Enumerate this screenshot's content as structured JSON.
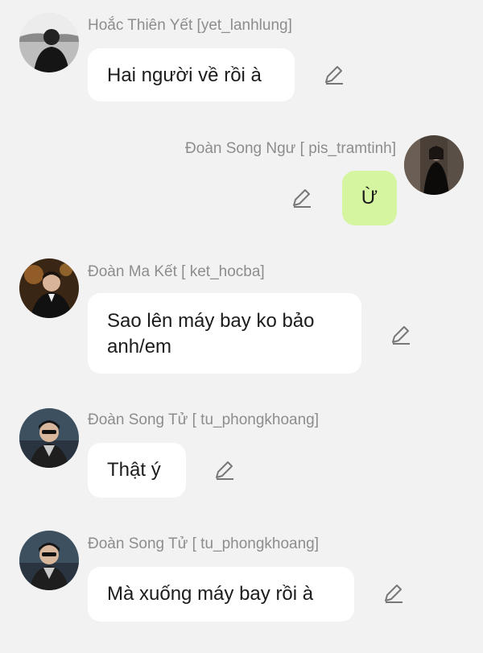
{
  "messages": [
    {
      "sender": "Hoắc Thiên Yết [yet_lanhlung]",
      "text": "Hai người về rồi à",
      "side": "left",
      "avatar_icon": "avatar-yet"
    },
    {
      "sender": "Đoàn Song Ngư [ pis_tramtinh]",
      "text": "Ừ",
      "side": "right",
      "avatar_icon": "avatar-pis"
    },
    {
      "sender": "Đoàn Ma Kết [ ket_hocba]",
      "text_lines": [
        "Sao lên máy bay ko bảo",
        "anh/em"
      ],
      "side": "left",
      "avatar_icon": "avatar-ket"
    },
    {
      "sender": "Đoàn Song Tử [ tu_phongkhoang]",
      "text": "Thật ý",
      "side": "left",
      "avatar_icon": "avatar-tu"
    },
    {
      "sender": "Đoàn Song Tử [ tu_phongkhoang]",
      "text": "Mà xuống máy bay rồi à",
      "side": "left",
      "avatar_icon": "avatar-tu"
    }
  ],
  "colors": {
    "background": "#f2f2f2",
    "bubble_incoming": "#ffffff",
    "bubble_outgoing": "#d6f5a0",
    "name_text": "#8d8d8d",
    "message_text": "#1c1c1c"
  }
}
